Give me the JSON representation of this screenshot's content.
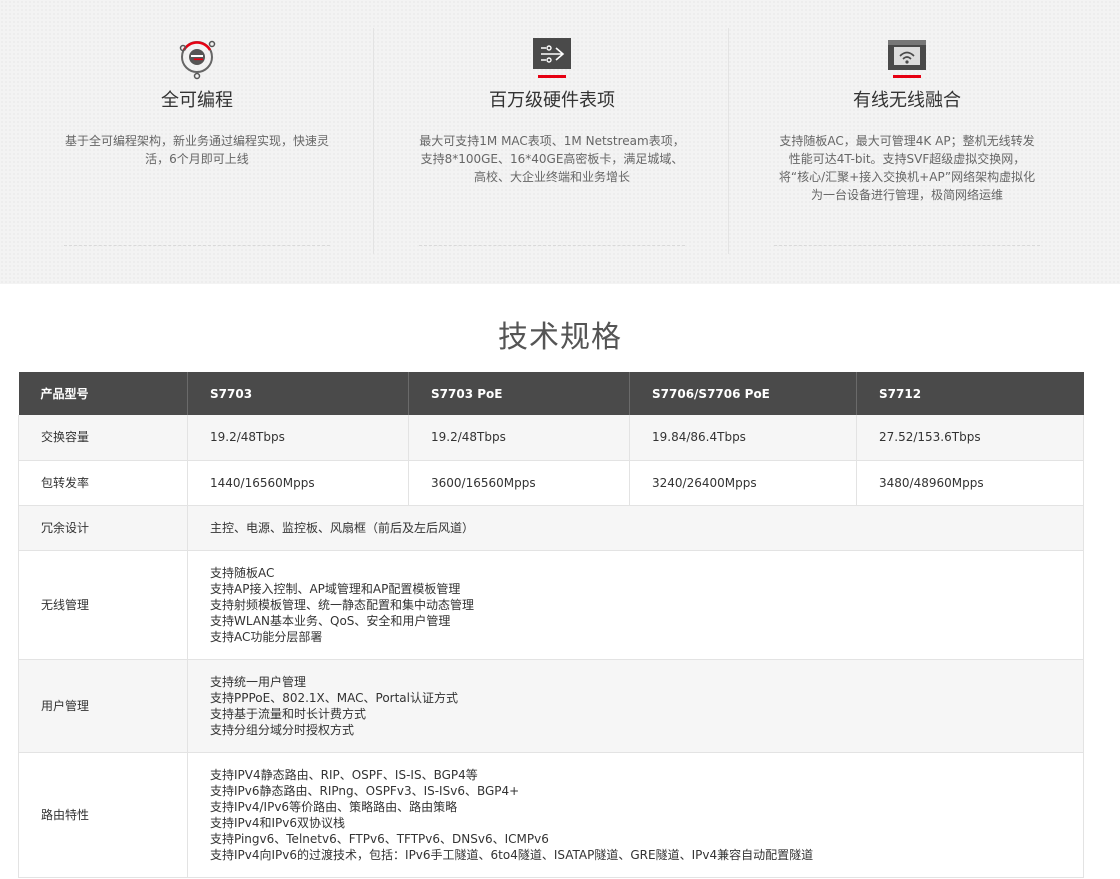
{
  "features": [
    {
      "icon": "programmable-icon",
      "title": "全可编程",
      "desc": "基于全可编程架构，新业务通过编程实现，快速灵活，6个月即可上线"
    },
    {
      "icon": "hardware-table-icon",
      "title": "百万级硬件表项",
      "desc": "最大可支持1M MAC表项、1M Netstream表项，支持8*100GE、16*40GE高密板卡，满足城域、高校、大企业终端和业务增长"
    },
    {
      "icon": "wireless-convergence-icon",
      "title": "有线无线融合",
      "desc": "支持随板AC，最大可管理4K AP；整机无线转发性能可达4T-bit。支持SVF超级虚拟交换网， 将“核心/汇聚+接入交换机+AP”网络架构虚拟化为一台设备进行管理，极简网络运维"
    }
  ],
  "colors": {
    "accent": "#e60012",
    "header_bg": "#4a4a4a",
    "row_alt": "#f6f6f6"
  },
  "spec_title": "技术规格",
  "table": {
    "headers": [
      "产品型号",
      "S7703",
      "S7703 PoE",
      "S7706/S7706 PoE",
      "S7712"
    ],
    "rows": {
      "capacity": {
        "label": "交换容量",
        "values": [
          "19.2/48Tbps",
          "19.2/48Tbps",
          "19.84/86.4Tbps",
          "27.52/153.6Tbps"
        ]
      },
      "forwarding": {
        "label": "包转发率",
        "values": [
          "1440/16560Mpps",
          "3600/16560Mpps",
          "3240/26400Mpps",
          "3480/48960Mpps"
        ]
      },
      "redundancy": {
        "label": "冗余设计",
        "text": "主控、电源、监控板、风扇框（前后及左后风道）"
      },
      "wireless": {
        "label": "无线管理",
        "lines": [
          "支持随板AC",
          "支持AP接入控制、AP域管理和AP配置模板管理",
          "支持射频模板管理、统一静态配置和集中动态管理",
          "支持WLAN基本业务、QoS、安全和用户管理",
          "支持AC功能分层部署"
        ]
      },
      "user": {
        "label": "用户管理",
        "lines": [
          "支持统一用户管理",
          "支持PPPoE、802.1X、MAC、Portal认证方式",
          "支持基于流量和时长计费方式",
          "支持分组分域分时授权方式"
        ]
      },
      "routing": {
        "label": "路由特性",
        "lines": [
          "支持IPV4静态路由、RIP、OSPF、IS-IS、BGP4等",
          "支持IPv6静态路由、RIPng、OSPFv3、IS-ISv6、BGP4+",
          "支持IPv4/IPv6等价路由、策略路由、路由策略",
          "支持IPv4和IPv6双协议栈",
          "支持Pingv6、Telnetv6、FTPv6、TFTPv6、DNSv6、ICMPv6",
          "支持IPv4向IPv6的过渡技术，包括：IPv6手工隧道、6to4隧道、ISATAP隧道、GRE隧道、IPv4兼容自动配置隧道"
        ]
      }
    }
  }
}
